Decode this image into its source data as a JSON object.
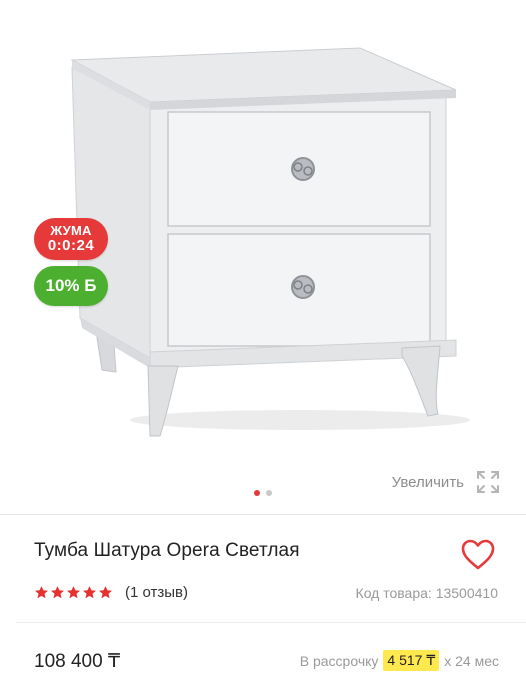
{
  "badges": {
    "friday_title": "ЖУМА",
    "friday_timer": "0:0:24",
    "bonus": "10% Б"
  },
  "gallery": {
    "zoom_label": "Увеличить",
    "zoom_icon": "expand-icon",
    "pages": 2,
    "active_page": 1
  },
  "product": {
    "title": "Тумба Шатура Opera Светлая",
    "favorite_icon": "heart-outline-icon",
    "rating_stars": 5,
    "reviews": "(1 отзыв)",
    "sku": "Код товара: 13500410"
  },
  "pricing": {
    "price": "108 400 ₸",
    "installment_prefix": "В рассрочку",
    "installment_amount": "4 517 ₸",
    "installment_suffix": "x 24 мес"
  },
  "colors": {
    "accent_red": "#e5393a",
    "bonus_green": "#4caf2f",
    "installment_highlight": "#ffe94f",
    "star_red": "#e3322f"
  }
}
